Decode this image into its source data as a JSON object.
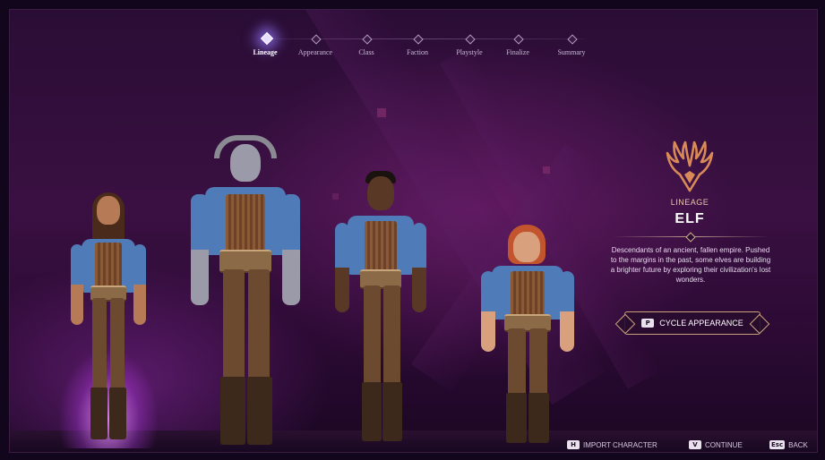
{
  "nav": {
    "steps": [
      {
        "label": "Lineage",
        "active": true
      },
      {
        "label": "Appearance",
        "active": false
      },
      {
        "label": "Class",
        "active": false
      },
      {
        "label": "Faction",
        "active": false
      },
      {
        "label": "Playstyle",
        "active": false
      },
      {
        "label": "Finalize",
        "active": false
      },
      {
        "label": "Summary",
        "active": false
      }
    ]
  },
  "panel": {
    "emblem_icon": "antler-emblem-icon",
    "section_label": "LINEAGE",
    "lineage_name": "ELF",
    "description": "Descendants of an ancient, fallen empire. Pushed to the margins in the past, some elves are building a brighter future by exploring their civilization's lost wonders.",
    "cycle_button": {
      "key": "P",
      "label": "CYCLE APPEARANCE"
    }
  },
  "actions": {
    "import": {
      "key": "H",
      "label": "IMPORT CHARACTER"
    },
    "continue": {
      "key": "V",
      "label": "CONTINUE"
    },
    "back": {
      "key": "Esc",
      "label": "BACK"
    }
  },
  "colors": {
    "accent": "#c9a27c",
    "background": "#2a0d35",
    "tunic_blue": "#4f7bb8"
  }
}
